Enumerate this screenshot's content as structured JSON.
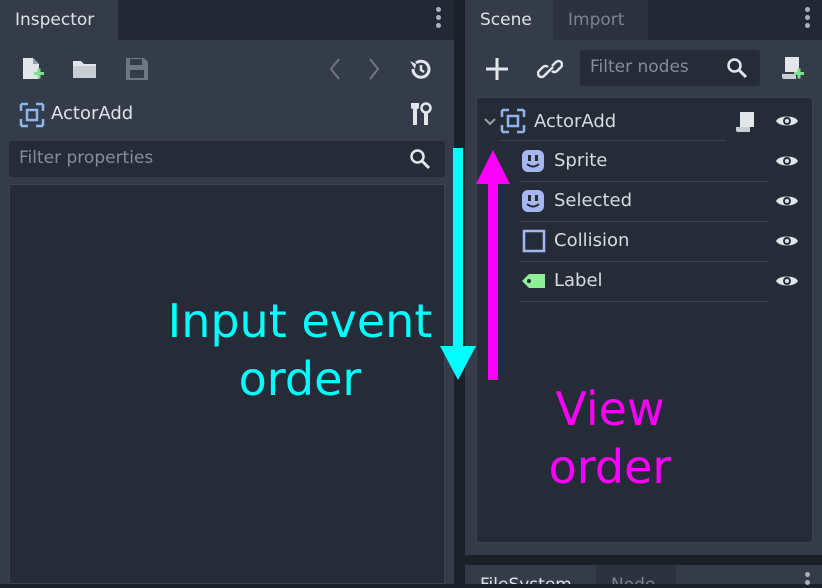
{
  "inspector": {
    "tab_label": "Inspector",
    "node_name": "ActorAdd",
    "filter_placeholder": "Filter properties"
  },
  "scene": {
    "tabs": [
      "Scene",
      "Import"
    ],
    "filter_placeholder": "Filter nodes",
    "root": {
      "label": "ActorAdd",
      "icon": "control-icon"
    },
    "children": [
      {
        "label": "Sprite",
        "icon": "sprite-icon"
      },
      {
        "label": "Selected",
        "icon": "sprite-icon"
      },
      {
        "label": "Collision",
        "icon": "collision-shape-icon"
      },
      {
        "label": "Label",
        "icon": "label-icon"
      }
    ]
  },
  "bottom_dock": {
    "tabs": [
      "FileSystem",
      "Node"
    ]
  },
  "annotations": {
    "input_order": "Input event\norder",
    "view_order": "View order",
    "input_color": "#00ffff",
    "view_color": "#ff00ff"
  }
}
